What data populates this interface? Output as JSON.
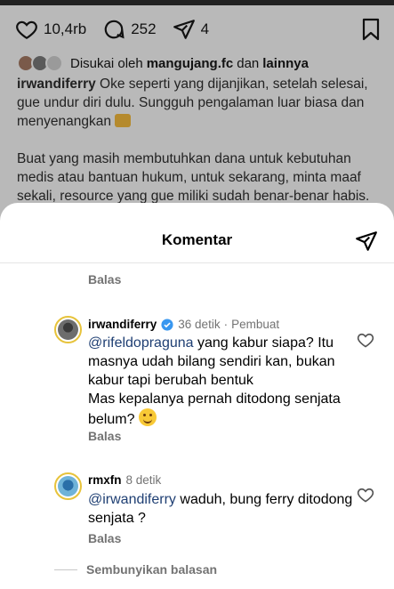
{
  "post": {
    "likes": "10,4rb",
    "comments": "252",
    "shares": "4",
    "liked_by_prefix": "Disukai oleh",
    "liked_by_user": "mangujang.fc",
    "liked_by_and": "dan",
    "liked_by_others": "lainnya",
    "caption_user": "irwandiferry",
    "caption_p1": "Oke seperti yang dijanjikan, setelah selesai, gue undur diri dulu. Sungguh pengalaman luar biasa dan menyenangkan",
    "caption_p2": "Buat yang masih membutuhkan dana untuk kebutuhan medis atau bantuan hukum, untuk sekarang, minta maaf sekali, resource yang gue miliki sudah benar-benar habis. Mungkin teman-teman bisa mencari"
  },
  "sheet": {
    "title": "Komentar"
  },
  "comments": [
    {
      "reply_label": "Balas"
    },
    {
      "user": "irwandiferry",
      "time": "36 detik",
      "sep": "·",
      "badge": "Pembuat",
      "mention": "@rifeldopraguna",
      "text": "yang kabur siapa? Itu masnya udah bilang sendiri kan, bukan kabur tapi berubah bentuk",
      "text2": "Mas kepalanya pernah ditodong senjata belum?",
      "reply_label": "Balas"
    },
    {
      "user": "rmxfn",
      "time": "8 detik",
      "mention": "@irwandiferry",
      "text": "waduh, bung ferry ditodong senjata ?",
      "reply_label": "Balas"
    }
  ],
  "hide_replies": "Sembunyikan balasan",
  "colors": {
    "mention": "#1f3f73",
    "verified": "#3897f0",
    "muted": "#737373"
  }
}
